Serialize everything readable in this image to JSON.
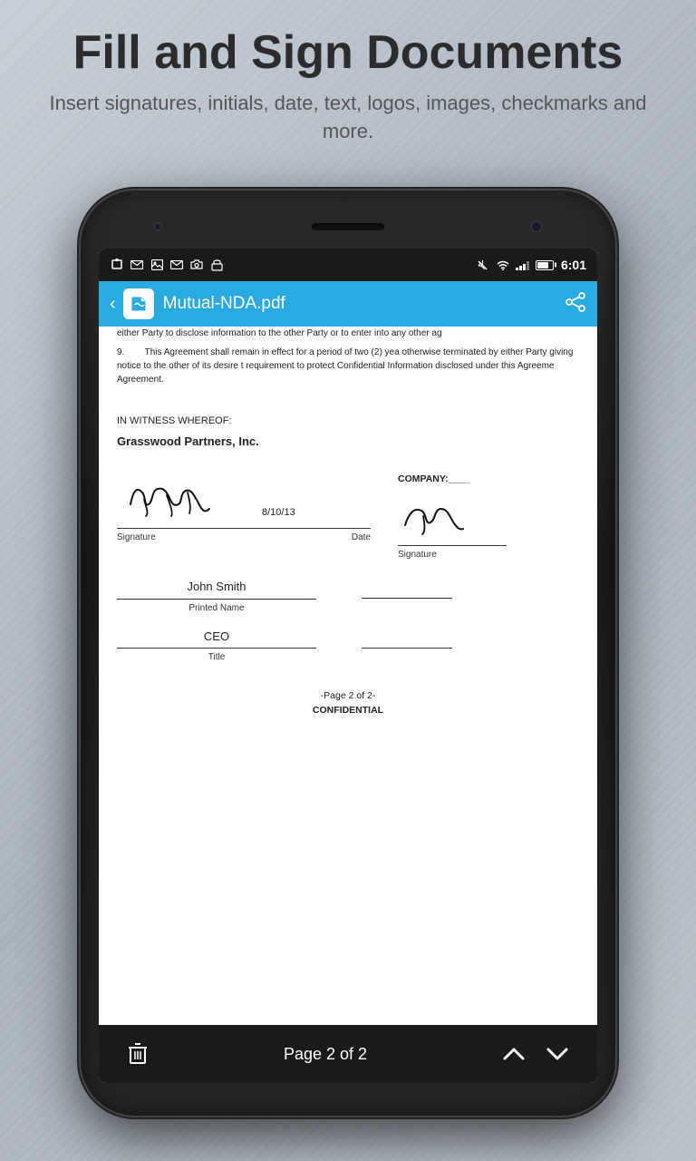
{
  "header": {
    "title": "Fill and Sign Documents",
    "subtitle": "Insert signatures, initials, date, text, logos, images, checkmarks and more."
  },
  "status_bar": {
    "time": "6:01",
    "icons": [
      "notification",
      "gmail",
      "image",
      "gmail2",
      "camera",
      "store"
    ],
    "mute": true,
    "wifi": true,
    "signal": true,
    "battery": 75
  },
  "app_bar": {
    "title": "Mutual-NDA.pdf",
    "back_label": "‹",
    "share_label": "share"
  },
  "document": {
    "para1": "either Party to disclose information to the other Party or to enter into any other ag",
    "para2_num": "9.",
    "para2_text": "This Agreement shall remain in effect for a period of two (2) yea otherwise terminated by either Party giving notice to the other of its desire t requirement to protect Confidential Information disclosed under this Agreeme Agreement.",
    "witness_label": "IN WITNESS WHEREOF:",
    "company_name": "Grasswood Partners, Inc.",
    "signer_name": "John Smith",
    "signer_title": "CEO",
    "sign_date": "8/10/13",
    "signature_label": "Signature",
    "date_label": "Date",
    "printed_name_label": "Printed Name",
    "title_label": "Title",
    "company_label": "COMPANY:____",
    "company_sig_label": "Signature",
    "page_footer": "-Page 2 of 2-",
    "confidential": "CONFIDENTIAL"
  },
  "bottom_nav": {
    "page_text": "Page 2 of 2",
    "trash_label": "trash",
    "up_label": "up",
    "down_label": "down"
  }
}
